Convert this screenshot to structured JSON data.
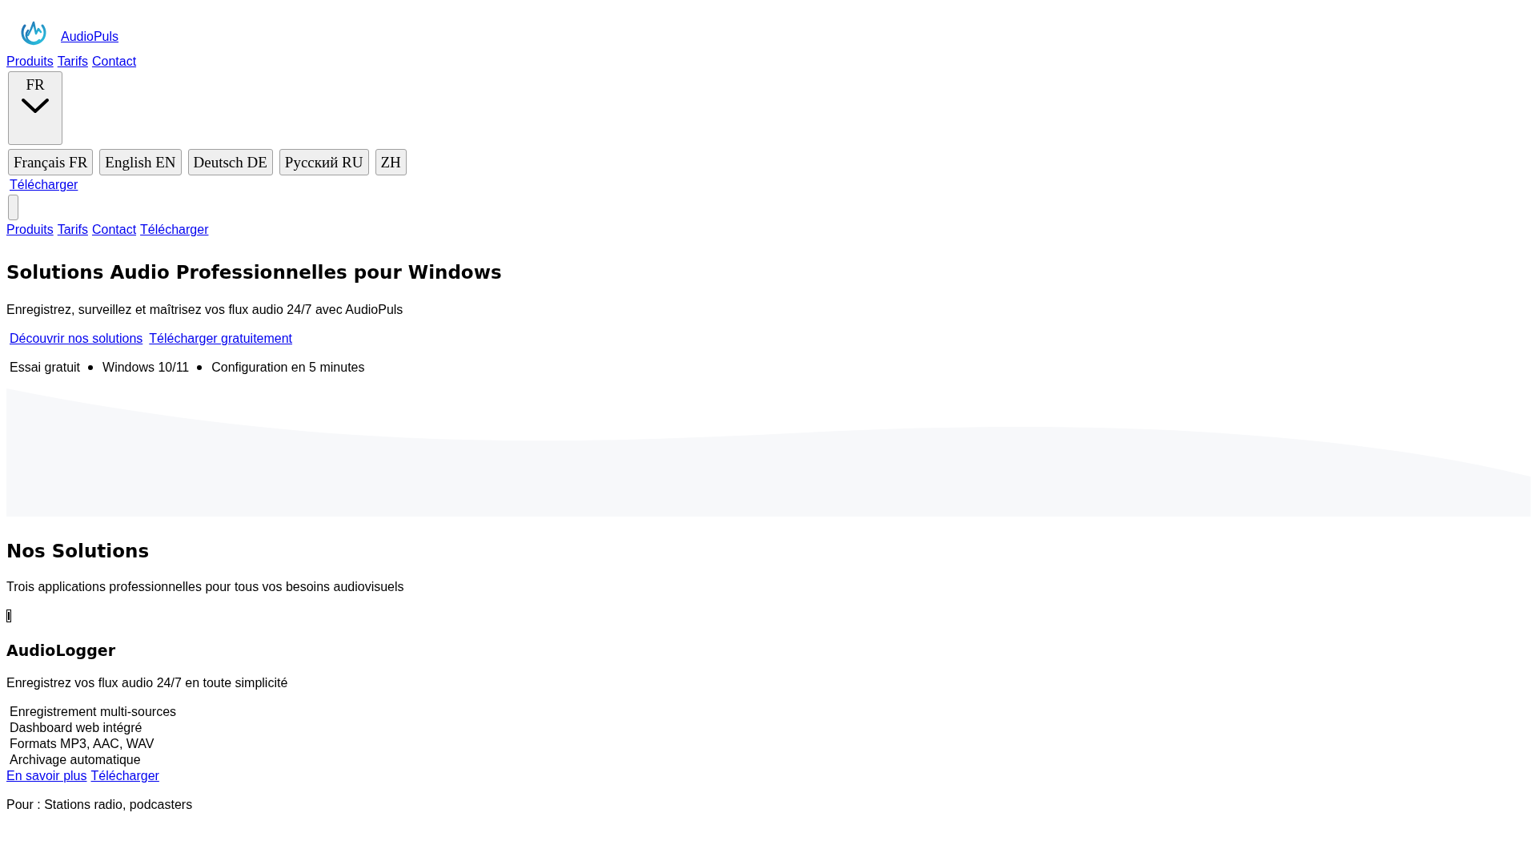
{
  "header": {
    "brand": "AudioPuls",
    "nav": [
      "Produits",
      "Tarifs",
      "Contact"
    ],
    "language_button": "FR",
    "languages": [
      {
        "label": "Français FR"
      },
      {
        "label": "English EN"
      },
      {
        "label": "Deutsch DE"
      },
      {
        "label": "Русский RU"
      },
      {
        "label": "ZH"
      }
    ],
    "download_link": "Télécharger"
  },
  "mobile_nav": [
    "Produits",
    "Tarifs",
    "Contact",
    "Télécharger"
  ],
  "hero": {
    "title": "Solutions Audio Professionnelles pour Windows",
    "subtitle": "Enregistrez, surveillez et maîtrisez vos flux audio 24/7 avec AudioPuls",
    "links": [
      "Découvrir nos solutions",
      "Télécharger gratuitement"
    ],
    "trust": [
      "Essai gratuit",
      "Windows 10/11",
      "Configuration en 5 minutes"
    ]
  },
  "solutions": {
    "title": "Nos Solutions",
    "subtitle": "Trois applications professionnelles pour tous vos besoins audiovisuels",
    "products": [
      {
        "name": "AudioLogger",
        "description": "Enregistrez vos flux audio 24/7 en toute simplicité",
        "features": [
          "Enregistrement multi-sources",
          "Dashboard web intégré",
          "Formats MP3, AAC, WAV",
          "Archivage automatique"
        ],
        "links": [
          "En savoir plus",
          "Télécharger"
        ],
        "audience": "Pour : Stations radio, podcasters"
      }
    ]
  }
}
